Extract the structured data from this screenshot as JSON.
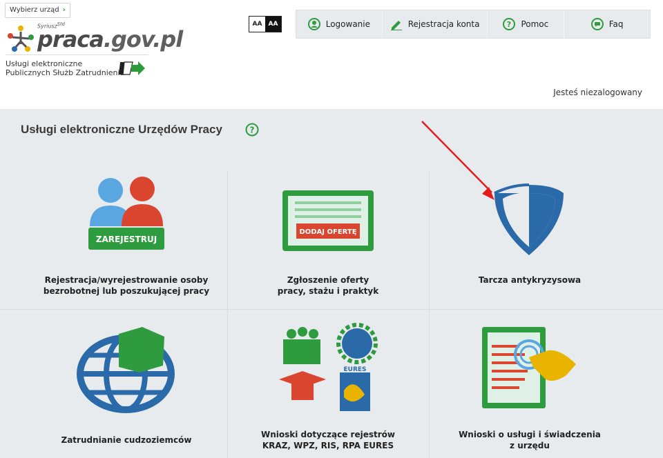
{
  "header": {
    "select_office": "Wybierz urząd",
    "logo_super": "Syriusz",
    "logo_super2": "Std",
    "logo_praca": "praca",
    "logo_gov": ".gov.pl",
    "services_line1": "Usługi elektroniczne",
    "services_line2": "Publicznych Służb Zatrudnienia",
    "contrast_normal": "AA",
    "contrast_high": "AA",
    "nav": [
      {
        "label": "Logowanie",
        "icon": "user-icon"
      },
      {
        "label": "Rejestracja konta",
        "icon": "pencil-icon"
      },
      {
        "label": "Pomoc",
        "icon": "help-icon"
      },
      {
        "label": "Faq",
        "icon": "chat-icon"
      }
    ],
    "status": "Jesteś niezalogowany"
  },
  "main": {
    "title": "Usługi elektroniczne Urzędów Pracy",
    "tiles": [
      {
        "line1": "Rejestracja/wyrejestrowanie osoby",
        "line2": "bezrobotnej lub poszukującej pracy",
        "badge": "ZAREJESTRUJ"
      },
      {
        "line1": "Zgłoszenie oferty",
        "line2": "pracy, stażu i praktyk",
        "badge": "DODAJ OFERTĘ"
      },
      {
        "line1": "Tarcza antykryzysowa",
        "line2": ""
      },
      {
        "line1": "Zatrudnianie cudzoziemców",
        "line2": ""
      },
      {
        "line1": "Wnioski dotyczące rejestrów",
        "line2": "KRAZ, WPZ, RIS, RPA EURES",
        "badge": "EURES"
      },
      {
        "line1": "Wnioski o usługi i świadczenia",
        "line2": "z urzędu"
      }
    ]
  },
  "colors": {
    "green": "#2e9b3f",
    "blue": "#2a6aa8",
    "red": "#d9452f",
    "yellow": "#e8b400",
    "background": "#e8ebee"
  }
}
